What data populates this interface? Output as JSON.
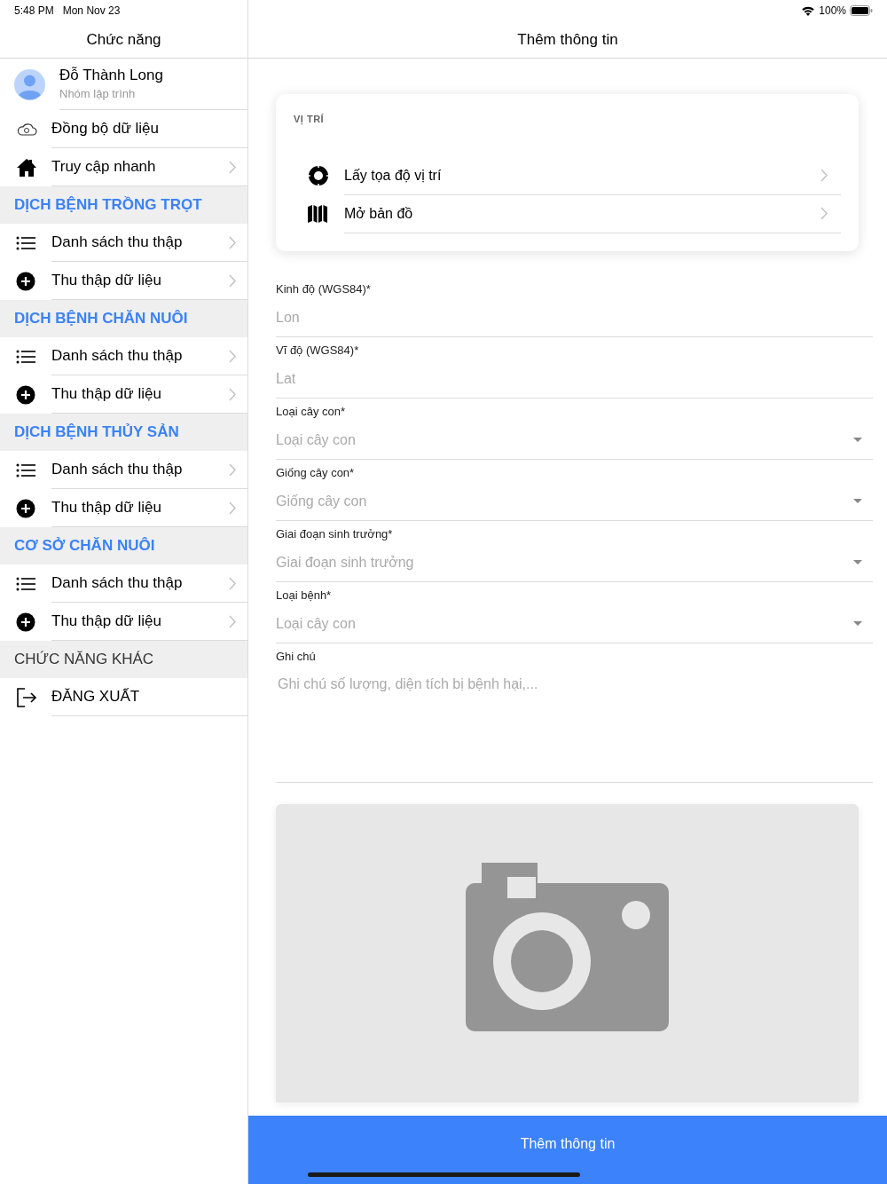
{
  "status_bar": {
    "time": "5:48 PM",
    "date": "Mon Nov 23",
    "battery": "100%"
  },
  "sidebar": {
    "title": "Chức năng",
    "profile": {
      "name": "Đỗ Thành Long",
      "group": "Nhóm lập trình"
    },
    "items": [
      {
        "kind": "cloud",
        "label": "Đồng bộ dữ liệu",
        "chevron": false
      },
      {
        "kind": "home",
        "label": "Truy cập nhanh",
        "chevron": true
      },
      {
        "kind": "header",
        "label": "DỊCH BỆNH TRỒNG TRỌT",
        "highlighted": true
      },
      {
        "kind": "list",
        "label": "Danh sách thu thập",
        "chevron": true
      },
      {
        "kind": "plus",
        "label": "Thu thập dữ liệu",
        "chevron": true
      },
      {
        "kind": "header",
        "label": "DỊCH BỆNH CHĂN NUÔI",
        "highlighted": true
      },
      {
        "kind": "list",
        "label": "Danh sách thu thập",
        "chevron": true
      },
      {
        "kind": "plus",
        "label": "Thu thập dữ liệu",
        "chevron": true
      },
      {
        "kind": "header",
        "label": "DỊCH BỆNH THỦY SẢN",
        "highlighted": true
      },
      {
        "kind": "list",
        "label": "Danh sách thu thập",
        "chevron": true
      },
      {
        "kind": "plus",
        "label": "Thu thập dữ liệu",
        "chevron": true
      },
      {
        "kind": "header",
        "label": "CƠ SỞ CHĂN NUÔI",
        "highlighted": true
      },
      {
        "kind": "list",
        "label": "Danh sách thu thập",
        "chevron": true
      },
      {
        "kind": "plus",
        "label": "Thu thập dữ liệu",
        "chevron": true
      },
      {
        "kind": "header",
        "label": "CHỨC NĂNG KHÁC",
        "highlighted": false
      },
      {
        "kind": "logout",
        "label": "ĐĂNG XUẤT",
        "chevron": false
      }
    ]
  },
  "main": {
    "title": "Thêm thông tin",
    "location_card": {
      "heading": "VỊ TRÍ",
      "items": [
        {
          "kind": "target",
          "label": "Lấy tọa độ vị trí"
        },
        {
          "kind": "map",
          "label": "Mở bản đồ"
        }
      ]
    },
    "fields": [
      {
        "kind": "text",
        "label": "Kinh độ (WGS84)*",
        "placeholder": "Lon"
      },
      {
        "kind": "text",
        "label": "Vĩ độ (WGS84)*",
        "placeholder": "Lat"
      },
      {
        "kind": "select",
        "label": "Loại cây con*",
        "placeholder": "Loại cây con"
      },
      {
        "kind": "select",
        "label": "Giống cây con*",
        "placeholder": "Giống cây con"
      },
      {
        "kind": "select",
        "label": "Giai đoạn sinh trưởng*",
        "placeholder": "Giai đoạn sinh trưởng"
      },
      {
        "kind": "select",
        "label": "Loại bệnh*",
        "placeholder": "Loại cây con"
      },
      {
        "kind": "textarea",
        "label": "Ghi chú",
        "placeholder": "Ghi chú số lượng, diện tích bị bệnh hại,..."
      }
    ],
    "submit": "Thêm thông tin"
  }
}
